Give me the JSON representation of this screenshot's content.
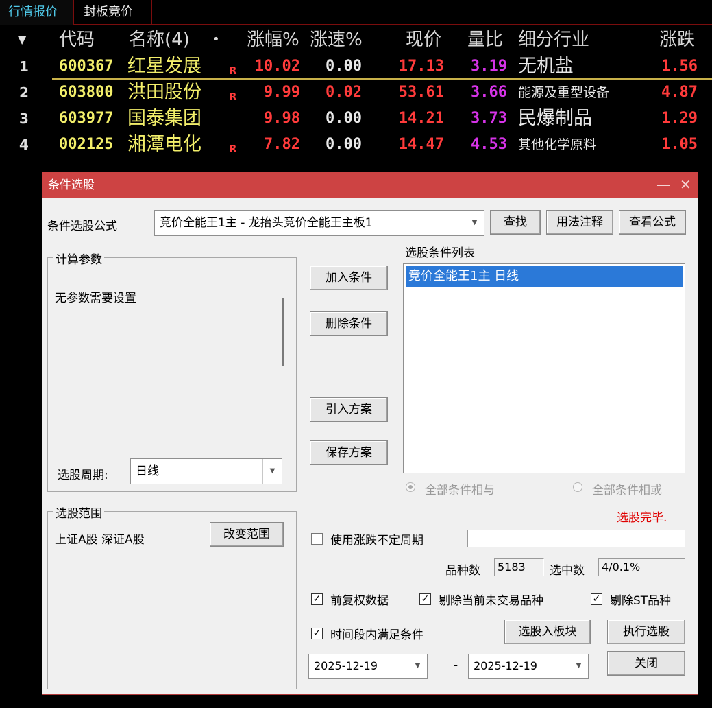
{
  "tabs": [
    "行情报价",
    "封板竞价"
  ],
  "table": {
    "sort_glyph": "▼",
    "headers": {
      "code": "代码",
      "name": "名称(4)",
      "dot": "•",
      "change_pct": "涨幅%",
      "speed_pct": "涨速%",
      "price": "现价",
      "vol_ratio": "量比",
      "industry": "细分行业",
      "change": "涨跌"
    },
    "rows": [
      {
        "no": "1",
        "code": "600367",
        "name": "红星发展",
        "badge": "R",
        "change_pct": "10.02",
        "speed_pct": "0.00",
        "price": "17.13",
        "vol_ratio": "3.19",
        "industry": "无机盐",
        "change": "1.56"
      },
      {
        "no": "2",
        "code": "603800",
        "name": "洪田股份",
        "badge": "R",
        "change_pct": "9.99",
        "speed_pct": "0.02",
        "price": "53.61",
        "vol_ratio": "3.66",
        "industry": "能源及重型设备",
        "change": "4.87"
      },
      {
        "no": "3",
        "code": "603977",
        "name": "国泰集团",
        "badge": "",
        "change_pct": "9.98",
        "speed_pct": "0.00",
        "price": "14.21",
        "vol_ratio": "3.73",
        "industry": "民爆制品",
        "change": "1.29"
      },
      {
        "no": "4",
        "code": "002125",
        "name": "湘潭电化",
        "badge": "R",
        "change_pct": "7.82",
        "speed_pct": "0.00",
        "price": "14.47",
        "vol_ratio": "4.53",
        "industry": "其他化学原料",
        "change": "1.05"
      }
    ]
  },
  "dialog": {
    "title": "条件选股",
    "minimize_glyph": "—",
    "close_glyph": "✕",
    "formula_label": "条件选股公式",
    "formula_value": "竞价全能王1主  -  龙抬头竞价全能王主板1",
    "btn_find": "查找",
    "btn_usage": "用法注释",
    "btn_view": "查看公式",
    "params_group": "计算参数",
    "params_text": "无参数需要设置",
    "period_label": "选股周期:",
    "period_value": "日线",
    "btn_add": "加入条件",
    "btn_delete": "删除条件",
    "btn_import": "引入方案",
    "btn_save": "保存方案",
    "list_title": "选股条件列表",
    "list_items": [
      "竞价全能王1主  日线"
    ],
    "radio_and": "全部条件相与",
    "radio_or": "全部条件相或",
    "status": "选股完毕.",
    "status_color": "#e00000",
    "range_group": "选股范围",
    "range_text": "上证A股 深证A股",
    "btn_change_range": "改变范围",
    "chk_variable_period": "使用涨跌不定周期",
    "variable_period_value": "",
    "count_label": "品种数",
    "count_value": "5183",
    "selected_label": "选中数",
    "selected_value": "4/0.1%",
    "chk_forward_adj": "前复权数据",
    "chk_exclude_untraded": "剔除当前未交易品种",
    "chk_exclude_st": "剔除ST品种",
    "chk_time_range": "时间段内满足条件",
    "btn_to_block": "选股入板块",
    "btn_execute": "执行选股",
    "date_from": "2025-12-19",
    "date_sep": "-",
    "date_to": "2025-12-19",
    "btn_close": "关闭",
    "check_glyph": "✓",
    "dropdown_glyph": "▼"
  },
  "colors": {
    "tab_active": "#4fc8e8",
    "code_yellow": "#f2ee6a",
    "up_red": "#ff3b3b",
    "vol_purple": "#d633e8",
    "dialog_title_bg": "#cd4343",
    "list_selected": "#2b79d8"
  }
}
